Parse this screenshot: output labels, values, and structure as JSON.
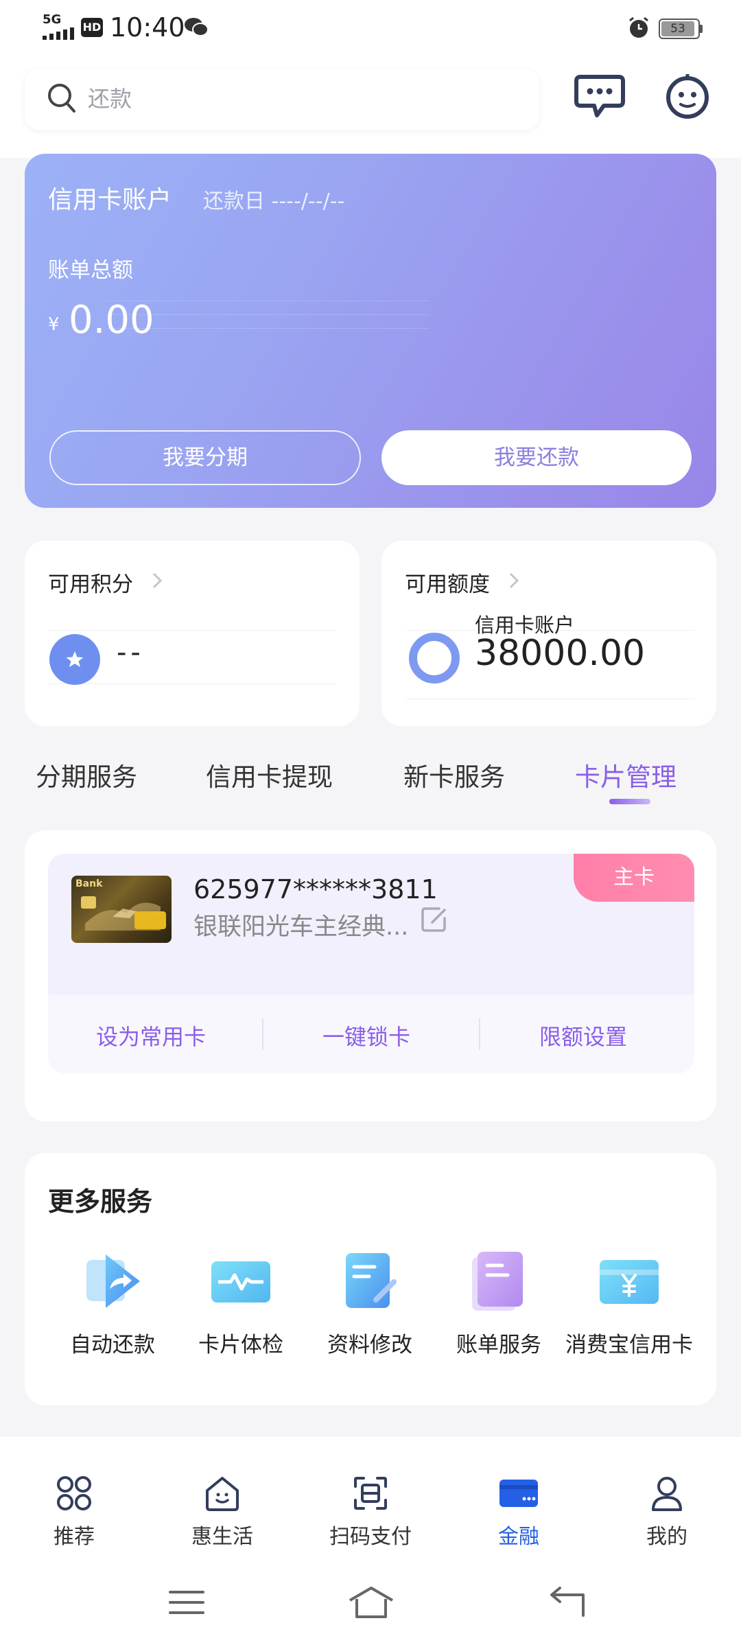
{
  "status_bar": {
    "network": "5G",
    "hd": "HD",
    "time": "10:40",
    "battery": "53"
  },
  "search": {
    "placeholder": "还款"
  },
  "credit_account": {
    "title": "信用卡账户",
    "due_label": "还款日 ----/--/--",
    "bill_label": "账单总额",
    "currency": "¥",
    "amount": "0.00",
    "installment_button": "我要分期",
    "repay_button": "我要还款"
  },
  "points": {
    "label": "可用积分",
    "value": "--"
  },
  "limit": {
    "label": "可用额度",
    "sub_label": "信用卡账户",
    "value": "38000.00"
  },
  "tabs": [
    {
      "label": "分期服务"
    },
    {
      "label": "信用卡提现"
    },
    {
      "label": "新卡服务"
    },
    {
      "label": "卡片管理"
    }
  ],
  "active_tab": 3,
  "card": {
    "image_label": "Bank",
    "number": "625977******3811",
    "name": "银联阳光车主经典...",
    "badge": "主卡",
    "actions": [
      {
        "label": "设为常用卡"
      },
      {
        "label": "一键锁卡"
      },
      {
        "label": "限额设置"
      }
    ]
  },
  "more_services": {
    "title": "更多服务",
    "items": [
      {
        "label": "自动还款",
        "icon": "auto-repay-icon"
      },
      {
        "label": "卡片体检",
        "icon": "card-checkup-icon"
      },
      {
        "label": "资料修改",
        "icon": "edit-info-icon"
      },
      {
        "label": "账单服务",
        "icon": "bill-service-icon"
      },
      {
        "label": "消费宝信用卡",
        "icon": "consume-card-icon"
      }
    ]
  },
  "bottom_nav": [
    {
      "label": "推荐",
      "icon": "grid-icon"
    },
    {
      "label": "惠生活",
      "icon": "home-icon"
    },
    {
      "label": "扫码支付",
      "icon": "scan-icon"
    },
    {
      "label": "金融",
      "icon": "card-icon"
    },
    {
      "label": "我的",
      "icon": "user-icon"
    }
  ],
  "active_nav": 3,
  "colors": {
    "accent_purple": "#8a5ee8",
    "nav_active_blue": "#2360e6",
    "badge_pink": "#ff7fa8"
  }
}
